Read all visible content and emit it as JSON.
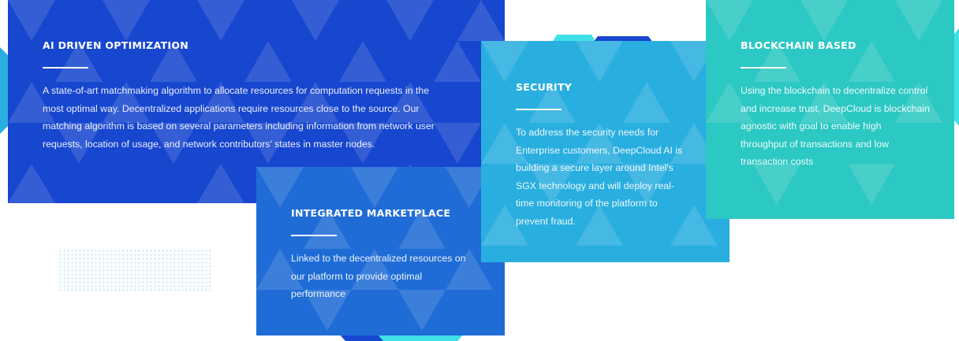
{
  "cards": {
    "ai": {
      "title": "AI DRIVEN OPTIMIZATION",
      "text": "A state-of-art matchmaking algorithm to allocate resources for computation requests in the most optimal way. Decentralized applications require resources close to the source. Our matching algorithm is based on several parameters including information from network user requests, location of usage, and network contributors' states in master nodes."
    },
    "marketplace": {
      "title": "INTEGRATED MARKETPLACE",
      "text": "Linked to the decentralized resources on our platform to provide optimal performance"
    },
    "security": {
      "title": "SECURITY",
      "text": "To address the security needs for Enterprise customers, DeepCloud AI is building a secure layer around Intel's SGX technology and will deploy real-time monitoring of the platform to prevent fraud."
    },
    "blockchain": {
      "title": "BLOCKCHAIN BASED",
      "text": "Using the blockchain to decentralize control and increase trust, DeepCloud is blockchain agnostic with goal to enable high throughput of transactions and low transaction costs"
    }
  },
  "colors": {
    "ai": "#1746cf",
    "marketplace": "#1f6cd6",
    "security": "#29aee0",
    "blockchain": "#2cc8c3",
    "accent_cyan": "#3fe0e6",
    "accent_blue": "#1746cf"
  }
}
